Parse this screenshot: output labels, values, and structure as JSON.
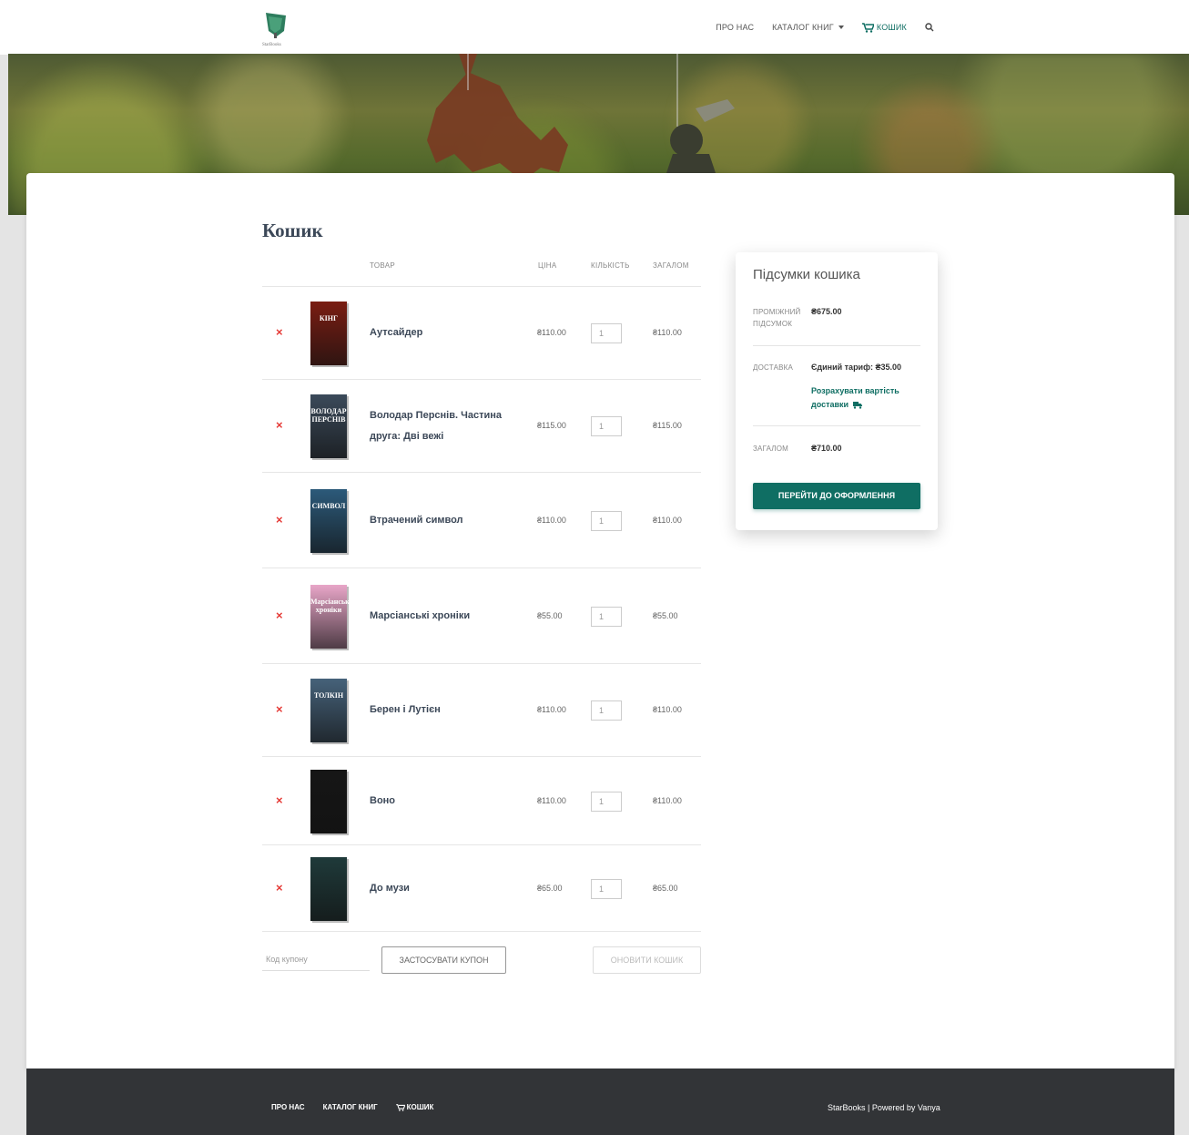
{
  "navbar": {
    "logo_text": "StarBooks",
    "links": [
      "Про нас",
      "Каталог книг",
      "Кошик"
    ],
    "search_icon": "search-icon"
  },
  "page": {
    "title": "Кошик"
  },
  "table": {
    "headers": {
      "product": "Товар",
      "price": "Ціна",
      "quantity": "Кількість",
      "total": "Загалом"
    }
  },
  "items": [
    {
      "name": "Аутсайдер",
      "price": "₴110.00",
      "qty": "1",
      "total": "₴110.00",
      "cover_color": "#7a1d12",
      "cover_text": "КІНГ"
    },
    {
      "name": "Володар Перснів. Частина друга: Дві вежі",
      "price": "₴115.00",
      "qty": "1",
      "total": "₴115.00",
      "cover_color": "#3b4a5a",
      "cover_text": "ВОЛОДАР ПЕРСНІВ"
    },
    {
      "name": "Втрачений символ",
      "price": "₴110.00",
      "qty": "1",
      "total": "₴110.00",
      "cover_color": "#2c5a7a",
      "cover_text": "СИМВОЛ"
    },
    {
      "name": "Марсіанські хроніки",
      "price": "₴55.00",
      "qty": "1",
      "total": "₴55.00",
      "cover_color": "#e8a6c8",
      "cover_text": "Марсіанські хроніки"
    },
    {
      "name": "Берен і Лутієн",
      "price": "₴110.00",
      "qty": "1",
      "total": "₴110.00",
      "cover_color": "#46627a",
      "cover_text": "ТОЛКІН"
    },
    {
      "name": "Воно",
      "price": "₴110.00",
      "qty": "1",
      "total": "₴110.00",
      "cover_color": "#161616",
      "cover_text": ""
    },
    {
      "name": "До музи",
      "price": "₴65.00",
      "qty": "1",
      "total": "₴65.00",
      "cover_color": "#1f3a3a",
      "cover_text": ""
    }
  ],
  "coupon": {
    "placeholder": "Код купону",
    "apply_label": "Застосувати купон",
    "update_label": "Оновити кошик"
  },
  "totals": {
    "title": "Підсумки кошика",
    "subtotal_label": "Проміжний підсумок",
    "subtotal_value": "₴675.00",
    "shipping_label": "Доставка",
    "shipping_value": "Єдиний тариф: ₴35.00",
    "shipping_calc": "Розрахувати вартість доставки",
    "total_label": "Загалом",
    "total_value": "₴710.00",
    "checkout_label": "Перейти до оформлення"
  },
  "footer": {
    "links": [
      "Про нас",
      "Каталог книг",
      "Кошик"
    ],
    "copyright": "StarBooks | Powered by Vanya"
  },
  "colors": {
    "accent": "#0f6e63",
    "remove": "#e53935",
    "footer_bg": "#323437"
  }
}
